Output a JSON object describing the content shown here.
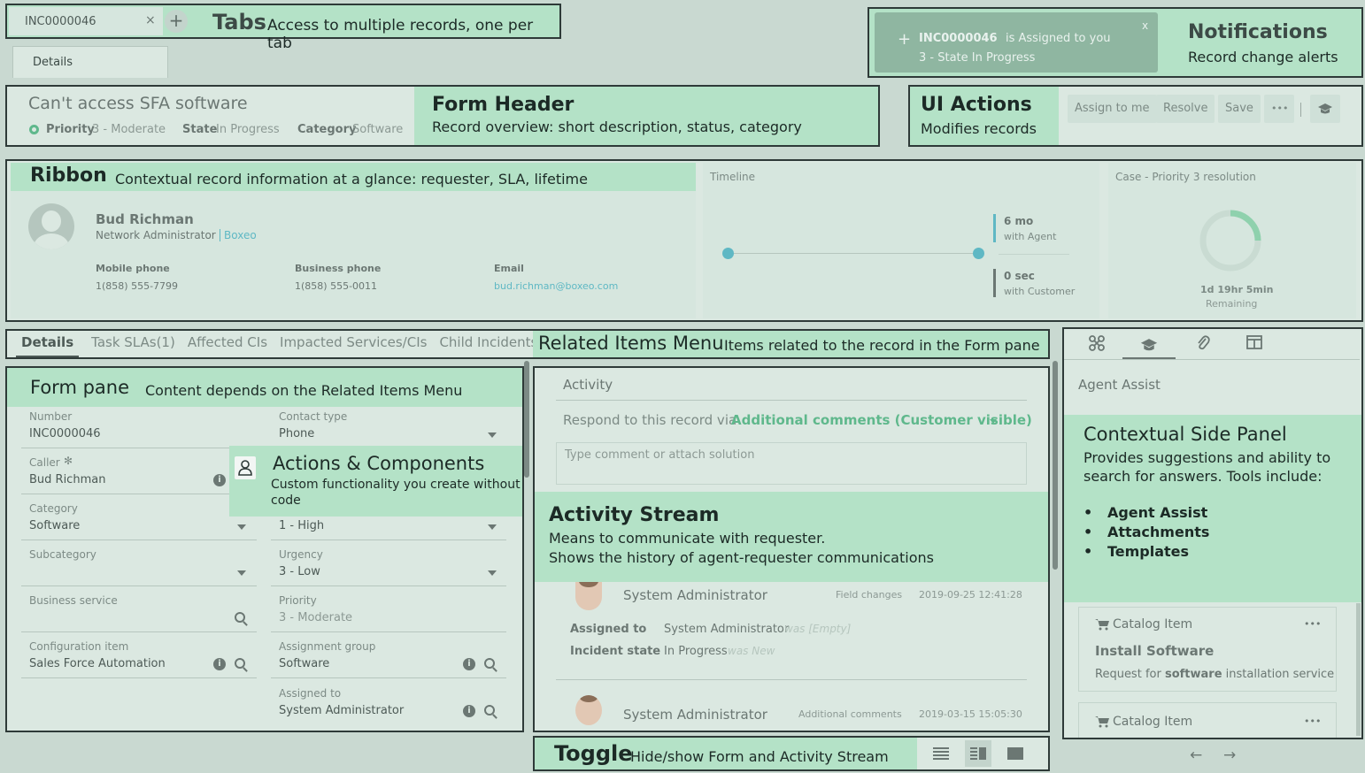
{
  "tabs": {
    "record_tab": "INC0000046",
    "close": "×",
    "add": "+",
    "callout_title": "Tabs",
    "callout_desc": "Access to multiple records, one per tab",
    "details_tab": "Details"
  },
  "notifications": {
    "plus": "+",
    "record": "INC0000046",
    "message": "is Assigned to you",
    "state": "3 - State In Progress",
    "close": "x",
    "callout_title": "Notifications",
    "callout_desc": "Record change alerts"
  },
  "form_header": {
    "title": "Can't access SFA software",
    "priority_label": "Priority",
    "priority_value": "3 - Moderate",
    "state_label": "State",
    "state_value": "In Progress",
    "category_label": "Category",
    "category_value": "Software",
    "callout_title": "Form Header",
    "callout_desc": "Record overview: short description, status, category"
  },
  "ui_actions": {
    "callout_title": "UI Actions",
    "callout_desc": "Modifies records",
    "assign": "Assign to me",
    "resolve": "Resolve",
    "save": "Save",
    "more": "•••"
  },
  "ribbon": {
    "callout_title": "Ribbon",
    "callout_desc": "Contextual record information at a glance: requester, SLA, lifetime",
    "name": "Bud Richman",
    "role": "Network Administrator",
    "company": "Boxeo",
    "mobile_label": "Mobile phone",
    "mobile_value": "1(858) 555-7799",
    "business_label": "Business phone",
    "business_value": "1(858) 555-0011",
    "email_label": "Email",
    "email_value": "bud.richman@boxeo.com",
    "timeline_label": "Timeline",
    "agent_time": "6 mo",
    "agent_label": "with Agent",
    "customer_time": "0 sec",
    "customer_label": "with Customer",
    "case_label": "Case - Priority 3 resolution",
    "remaining": "1d 19hr 5min",
    "remaining_label": "Remaining"
  },
  "related_menu": {
    "tabs": [
      "Details",
      "Task SLAs(1)",
      "Affected CIs",
      "Impacted Services/CIs",
      "Child Incidents"
    ],
    "callout_title": "Related Items Menu",
    "callout_desc": "Items related to the record in the Form pane"
  },
  "form_pane": {
    "callout_title": "Form pane",
    "callout_desc": "Content depends on the Related Items Menu",
    "number_label": "Number",
    "number_value": "INC0000046",
    "contact_label": "Contact type",
    "contact_value": "Phone",
    "caller_label": "Caller",
    "caller_req": "✻",
    "caller_value": "Bud Richman",
    "category_label": "Category",
    "category_value": "Software",
    "impact_value": "1 - High",
    "subcategory_label": "Subcategory",
    "urgency_label": "Urgency",
    "urgency_value": "3 - Low",
    "business_service_label": "Business service",
    "priority_label": "Priority",
    "priority_value": "3 - Moderate",
    "config_label": "Configuration item",
    "config_value": "Sales Force Automation",
    "assign_group_label": "Assignment group",
    "assign_group_value": "Software",
    "assigned_to_label": "Assigned to",
    "assigned_to_value": "System Administrator"
  },
  "actions_components": {
    "callout_title": "Actions & Components",
    "callout_desc": "Custom functionality you create without code"
  },
  "activity": {
    "title": "Activity",
    "respond_text": "Respond to this record via",
    "respond_option": "Additional comments (Customer visible)",
    "placeholder": "Type comment or attach solution",
    "callout_title": "Activity Stream",
    "callout_desc1": "Means to communicate with requester.",
    "callout_desc2": "Shows the history of agent-requester communications",
    "entry1_author": "System Administrator",
    "entry1_type": "Field changes",
    "entry1_time": "2019-09-25 12:41:28",
    "assigned_label": "Assigned to",
    "assigned_value": "System Administrator",
    "assigned_was": "was [Empty]",
    "state_label": "Incident state",
    "state_value": "In Progress",
    "state_was": "was New",
    "entry2_author": "System Administrator",
    "entry2_type": "Additional comments",
    "entry2_time": "2019-03-15 15:05:30"
  },
  "toggle": {
    "callout_title": "Toggle",
    "callout_desc": "Hide/show Form and Activity Stream"
  },
  "side_panel": {
    "title": "Agent Assist",
    "callout_title": "Contextual Side Panel",
    "callout_desc": "Provides suggestions and ability to search for answers. Tools include:",
    "items": [
      "Agent Assist",
      "Attachments",
      "Templates"
    ],
    "card1_type": "Catalog Item",
    "card1_title": "Install Software",
    "card1_desc_pre": "Request for",
    "card1_desc_bold": "software",
    "card1_desc_post": "installation service",
    "card2_type": "Catalog Item",
    "more": "•••",
    "prev": "←",
    "next": "→"
  }
}
